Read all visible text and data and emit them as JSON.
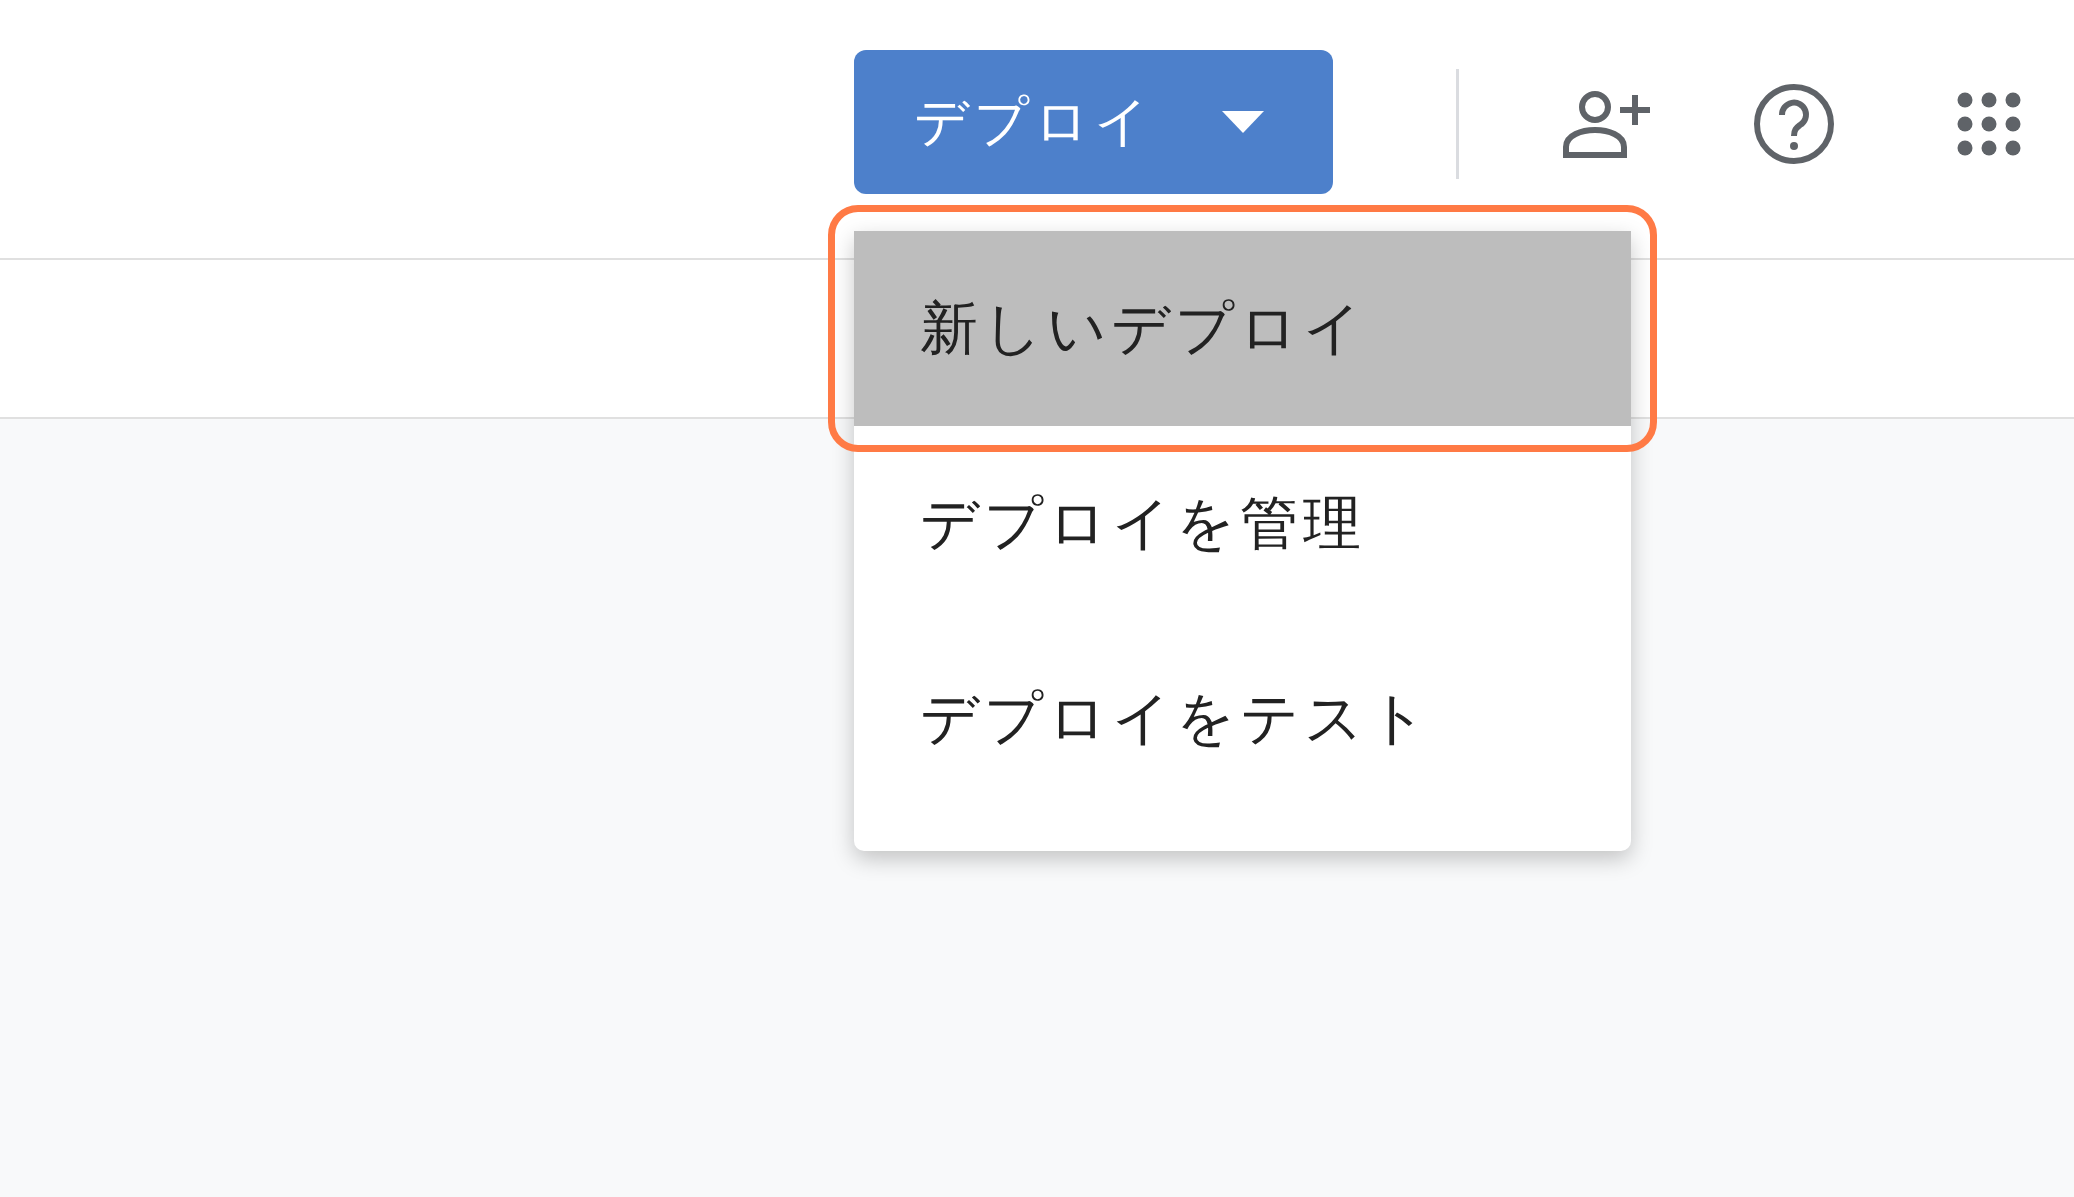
{
  "toolbar": {
    "deploy_button": {
      "label": "デプロイ",
      "expanded": true
    }
  },
  "menu": {
    "items": [
      {
        "label": "新しいデプロイ",
        "selected": true
      },
      {
        "label": "デプロイを管理",
        "selected": false
      },
      {
        "label": "デプロイをテスト",
        "selected": false
      }
    ]
  }
}
